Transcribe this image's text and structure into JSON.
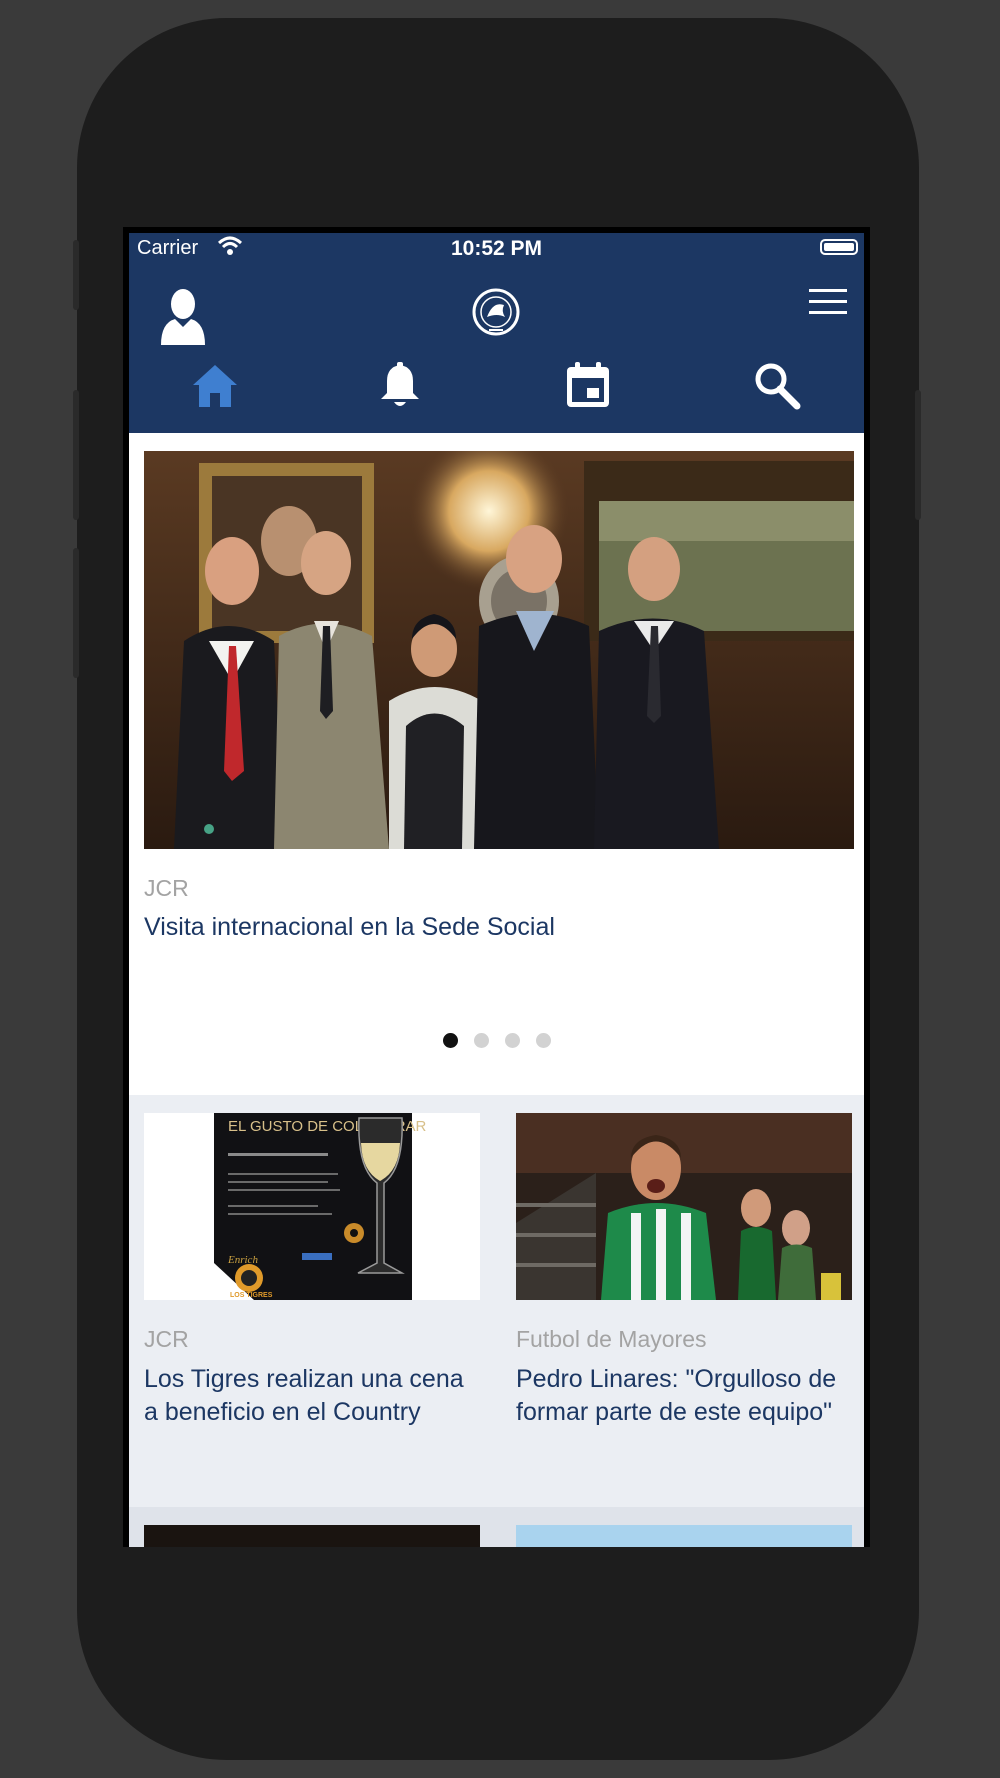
{
  "status_bar": {
    "carrier": "Carrier",
    "time": "10:52 PM"
  },
  "nav": {
    "icons": [
      "person-icon",
      "club-logo",
      "menu-icon"
    ],
    "tabs": [
      {
        "name": "home",
        "icon": "home-icon",
        "active": true
      },
      {
        "name": "notifications",
        "icon": "bell-icon",
        "active": false
      },
      {
        "name": "calendar",
        "icon": "calendar-icon",
        "active": false
      },
      {
        "name": "search",
        "icon": "search-icon",
        "active": false
      }
    ]
  },
  "hero": {
    "category": "JCR",
    "title": "Visita internacional en la Sede Social",
    "page_count": 4,
    "active_page": 1
  },
  "cards": [
    {
      "category": "JCR",
      "title": "Los Tigres realizan una cena a beneficio en el Country",
      "image_text": "EL GUSTO DE COLABORAR",
      "brand": "LOS TIGRES"
    },
    {
      "category": "Futbol de Mayores",
      "title": "Pedro Linares: \"Orgulloso de formar parte de este equipo\""
    }
  ],
  "colors": {
    "nav_bg": "#1c3763",
    "active_tab": "#3f7fd0",
    "title": "#1c3763",
    "category": "#a3a3a3",
    "grid_bg": "#ebeef3"
  }
}
